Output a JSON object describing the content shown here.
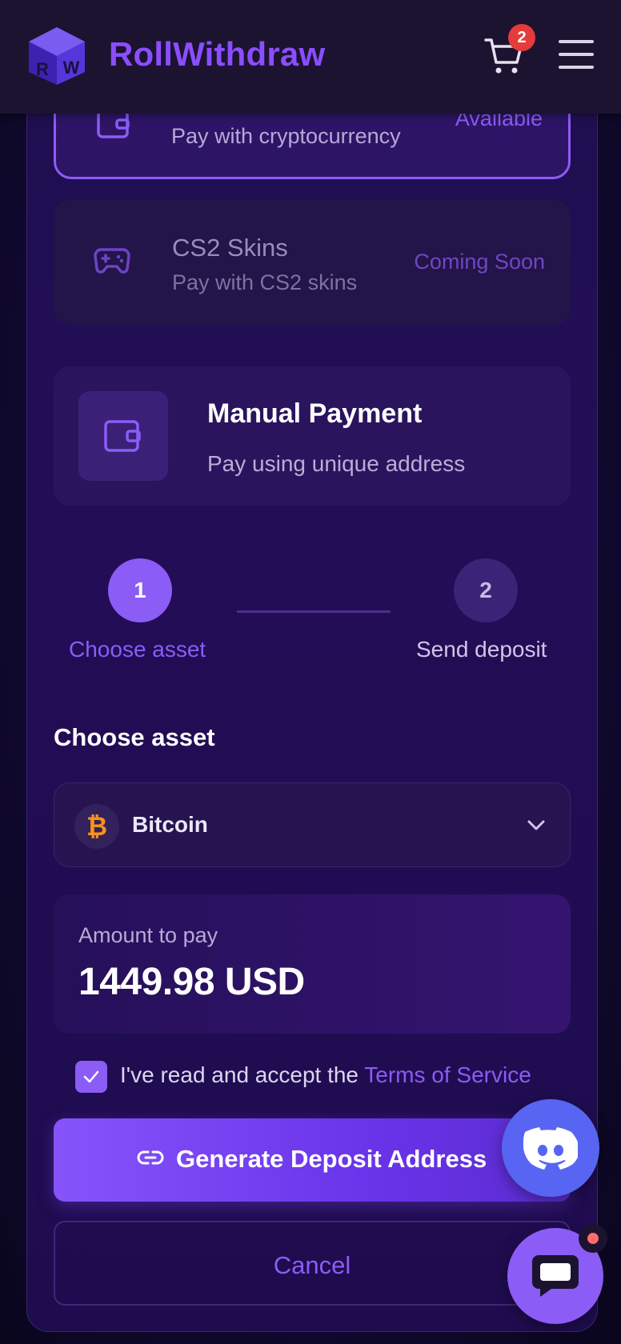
{
  "header": {
    "brand": "RollWithdraw",
    "logo_text": "RW",
    "cart_count": "2",
    "icons": [
      "cart-icon",
      "hamburger-icon"
    ]
  },
  "methods": {
    "crypto": {
      "subtitle": "Pay with cryptocurrency",
      "status": "Available"
    },
    "skins": {
      "title": "CS2 Skins",
      "subtitle": "Pay with CS2 skins",
      "status": "Coming Soon"
    },
    "manual": {
      "title": "Manual Payment",
      "subtitle": "Pay using unique address"
    }
  },
  "stepper": {
    "steps": [
      {
        "number": "1",
        "label": "Choose asset",
        "active": true
      },
      {
        "number": "2",
        "label": "Send deposit",
        "active": false
      }
    ]
  },
  "asset": {
    "section_title": "Choose asset",
    "selected": "Bitcoin",
    "coin_icon": "bitcoin-icon"
  },
  "amount": {
    "label": "Amount to pay",
    "value": "1449.98 USD"
  },
  "terms": {
    "prefix": "I've read and accept the ",
    "link": "Terms of Service",
    "checked": true
  },
  "actions": {
    "generate": "Generate Deposit Address",
    "cancel": "Cancel"
  },
  "colors": {
    "accent": "#8b5cf6",
    "discord": "#5865f2",
    "badge": "#e43b3b",
    "bitcoin": "#f7931a"
  }
}
